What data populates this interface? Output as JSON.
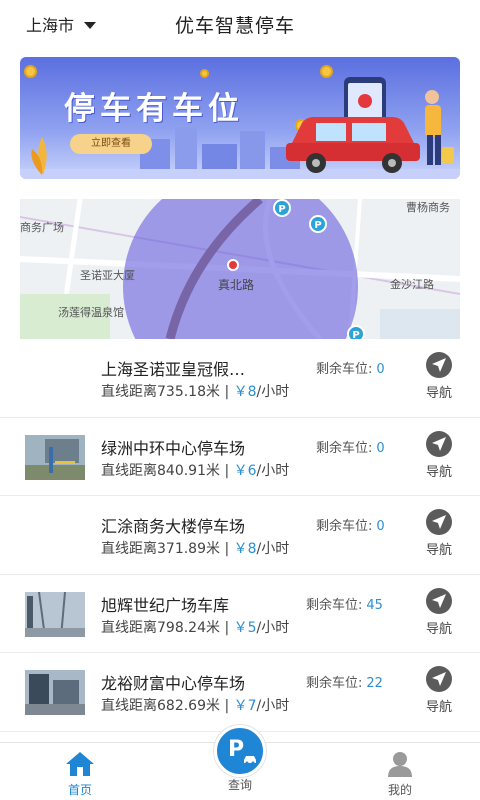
{
  "header": {
    "city": "上海市",
    "title": "优车智慧停车"
  },
  "banner": {
    "title": "停车有车位",
    "button": "立即查看"
  },
  "map": {
    "labels": [
      "商务广场",
      "圣诺亚大厦",
      "汤莲得温泉馆",
      "真北路",
      "金沙江路",
      "曹杨商务"
    ]
  },
  "remain_label": "剩余车位:",
  "nav_label": "导航",
  "lots": [
    {
      "name": "上海圣诺亚皇冠假…",
      "remain": "0",
      "distance": "直线距离735.18米",
      "sep": " | ",
      "price": "￥8",
      "unit": "/小时",
      "thumb": false
    },
    {
      "name": "绿洲中环中心停车场",
      "remain": "0",
      "distance": "直线距离840.91米",
      "sep": " | ",
      "price": "￥6",
      "unit": "/小时",
      "thumb": true
    },
    {
      "name": "汇涂商务大楼停车场",
      "remain": "0",
      "distance": "直线距离371.89米",
      "sep": " | ",
      "price": "￥8",
      "unit": "/小时",
      "thumb": false
    },
    {
      "name": "旭辉世纪广场车库",
      "remain": "45",
      "distance": "直线距离798.24米",
      "sep": " | ",
      "price": "￥5",
      "unit": "/小时",
      "thumb": true
    },
    {
      "name": "龙裕财富中心停车场",
      "remain": "22",
      "distance": "直线距离682.69米",
      "sep": " | ",
      "price": "￥7",
      "unit": "/小时",
      "thumb": true
    }
  ],
  "tabs": {
    "home": "首页",
    "query": "查询",
    "mine": "我的"
  },
  "colors": {
    "accent": "#1f86d6",
    "count": "#2b8fd1",
    "circle": "#6b63de"
  }
}
